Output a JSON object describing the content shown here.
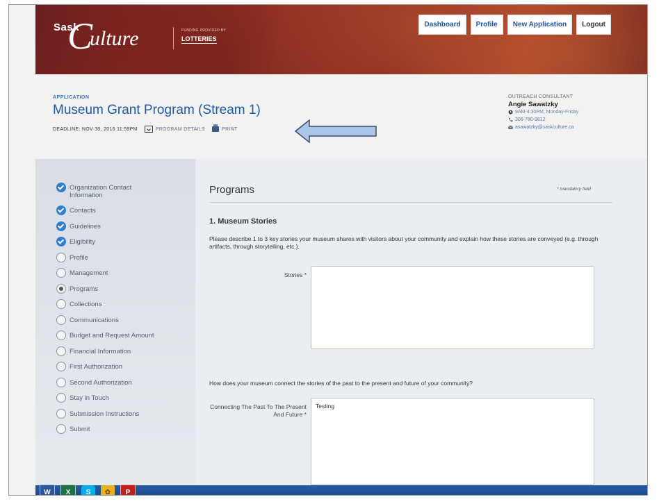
{
  "header": {
    "logo": {
      "sask": "Sask",
      "c": "C",
      "culture": "ulture",
      "funding": "FUNDING PROVIDED BY",
      "lotteries": "LOTTERIES"
    },
    "nav": [
      {
        "label": "Dashboard",
        "icon": "dashboard"
      },
      {
        "label": "Profile",
        "icon": "profile"
      },
      {
        "label": "New Application",
        "icon": "new-application"
      },
      {
        "label": "Logout",
        "icon": "logout"
      }
    ]
  },
  "application": {
    "label": "APPLICATION",
    "title": "Museum Grant Program (Stream 1)",
    "deadline": "DEADLINE: NOV 30, 2016 11:59PM",
    "program_details": "PROGRAM DETAILS",
    "print": "PRINT"
  },
  "consultant": {
    "label": "OUTREACH CONSULTANT",
    "name": "Angie Sawatzky",
    "hours": "9AM-4:30PM, Monday-Friday",
    "phone": "306-780-9812",
    "email": "asawatzky@saskculture.ca"
  },
  "sidebar": {
    "steps": [
      {
        "label": "Organization Contact Information",
        "status": "complete"
      },
      {
        "label": "Contacts",
        "status": "complete"
      },
      {
        "label": "Guidelines",
        "status": "complete"
      },
      {
        "label": "Eligibility",
        "status": "complete"
      },
      {
        "label": "Profile",
        "status": "incomplete"
      },
      {
        "label": "Management",
        "status": "incomplete"
      },
      {
        "label": "Programs",
        "status": "current"
      },
      {
        "label": "Collections",
        "status": "incomplete"
      },
      {
        "label": "Communications",
        "status": "incomplete"
      },
      {
        "label": "Budget and Request Amount",
        "status": "incomplete"
      },
      {
        "label": "Financial Information",
        "status": "incomplete"
      },
      {
        "label": "First Authorization",
        "status": "incomplete"
      },
      {
        "label": "Second Authorization",
        "status": "incomplete"
      },
      {
        "label": "Stay in Touch",
        "status": "incomplete"
      },
      {
        "label": "Submission Instructions",
        "status": "incomplete"
      },
      {
        "label": "Submit",
        "status": "incomplete"
      }
    ]
  },
  "main": {
    "title": "Programs",
    "mandatory_note": "* mandatory field",
    "section_heading": "1. Museum Stories",
    "question1": "Please describe 1 to 3 key stories your museum shares with visitors about your community and explain how these stories are conveyed (e.g. through artifacts, through storytelling, etc.).",
    "stories_label": "Stories *",
    "stories_value": "",
    "question2": "How does your museum connect the stories of the past to the present and future of your community?",
    "connecting_label": "Connecting The Past To The Present And Future *",
    "connecting_value": "Testing"
  },
  "taskbar": {
    "apps": [
      {
        "name": "word",
        "glyph": "W"
      },
      {
        "name": "excel",
        "glyph": "X"
      },
      {
        "name": "skype",
        "glyph": "S"
      },
      {
        "name": "app",
        "glyph": "✿"
      },
      {
        "name": "pdf",
        "glyph": "P"
      }
    ]
  },
  "colors": {
    "brand_red": "#8e2a23",
    "link_blue": "#1f5aa1",
    "check_blue": "#2f7fd1",
    "arrow_fill": "#a9c6e8"
  }
}
